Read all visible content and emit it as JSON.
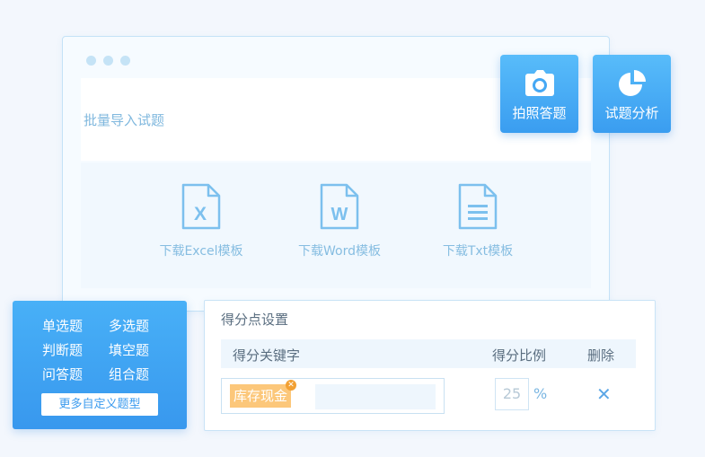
{
  "window": {
    "panel_title": "批量导入试题",
    "templates": [
      {
        "label": "下载Excel模板",
        "letter": "X"
      },
      {
        "label": "下载Word模板",
        "letter": "W"
      },
      {
        "label": "下载Txt模板",
        "letter": ""
      }
    ]
  },
  "float_buttons": {
    "photo": "拍照答题",
    "analysis": "试题分析"
  },
  "question_types": {
    "items": [
      "单选题",
      "多选题",
      "判断题",
      "填空题",
      "问答题",
      "组合题"
    ],
    "more": "更多自定义题型"
  },
  "score_settings": {
    "title": "得分点设置",
    "headers": {
      "keyword": "得分关键字",
      "ratio": "得分比例",
      "delete": "删除"
    },
    "row": {
      "tag": "库存现金",
      "ratio": "25",
      "unit": "%",
      "delete_symbol": "✕"
    }
  },
  "colors": {
    "accent": "#3a9df0",
    "tag": "#fcc77a",
    "icon": "#7cc0ee"
  }
}
